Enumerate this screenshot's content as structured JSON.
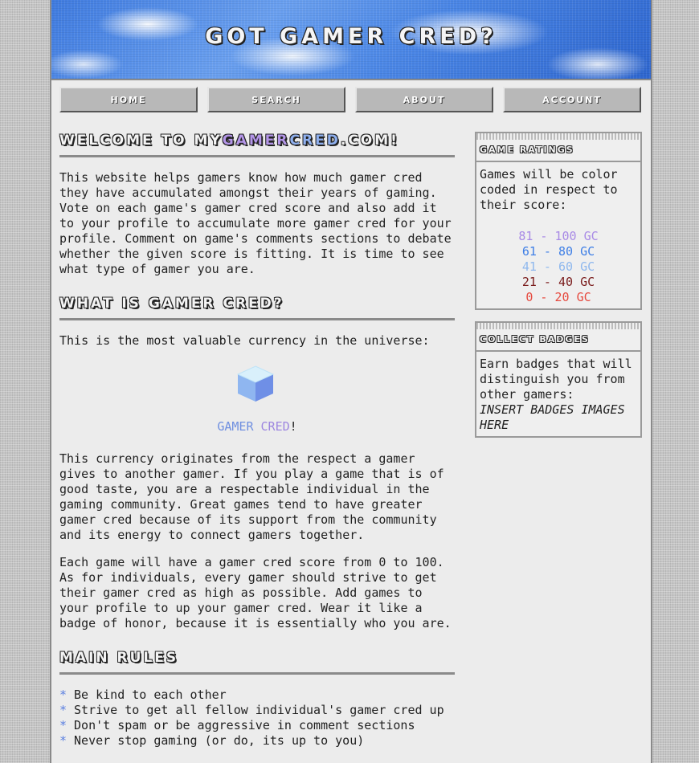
{
  "header": {
    "title": "Got Gamer Cred?"
  },
  "nav": {
    "items": [
      "Home",
      "Search",
      "About",
      "Account"
    ]
  },
  "welcome": {
    "title_prefix": "Welcome to My",
    "brand_part1": "Gamer",
    "brand_part2": "Cred",
    "title_suffix": ".com!",
    "body": "This website helps gamers know how much gamer cred they have accumulated amongst their years of gaming. Vote on each game's gamer cred score and also add it to your profile to accumulate more gamer cred for your profile. Comment on game's comments sections to debate whether the given score is fitting. It is time to see what type of gamer you are."
  },
  "what_is": {
    "title": "What is Gamer Cred?",
    "intro": "This is the most valuable currency in the universe:",
    "cred_word1": "GAMER",
    "cred_word2": "CRED",
    "cred_bang": "!",
    "para1": "This currency originates from the respect a gamer gives to another gamer. If you play a game that is of good taste, you are a respectable individual in the gaming community. Great games tend to have greater gamer cred because of its support from the community and its energy to connect gamers together.",
    "para2": "Each game will have a gamer cred score from 0 to 100. As for individuals, every gamer should strive to get their gamer cred as high as possible. Add games to your profile to up your gamer cred. Wear it like a badge of honor, because it is essentially who you are."
  },
  "rules": {
    "title": "Main Rules",
    "bullet": "*",
    "items": [
      "Be kind to each other",
      "Strive to get all fellow individual's gamer cred up",
      "Don't spam or be aggressive in comment sections",
      "Never stop gaming (or do, its up to you)"
    ]
  },
  "ratings": {
    "title": "Game Ratings",
    "intro": "Games will be color coded in respect to their score:",
    "rows": [
      {
        "label": "81 - 100 GC",
        "color": "#a98be6"
      },
      {
        "label": "61 - 80 GC",
        "color": "#3f7fe6"
      },
      {
        "label": "41 - 60 GC",
        "color": "#8fb8ee"
      },
      {
        "label": "21 - 40 GC",
        "color": "#7a1c1c"
      },
      {
        "label": "0 - 20 GC",
        "color": "#e64a3f"
      }
    ]
  },
  "badges": {
    "title": "Collect Badges",
    "body": "Earn badges that will distinguish you from other gamers:",
    "placeholder": "INSERT BADGES IMAGES HERE"
  },
  "icons": {
    "currency": "cube-icon"
  }
}
